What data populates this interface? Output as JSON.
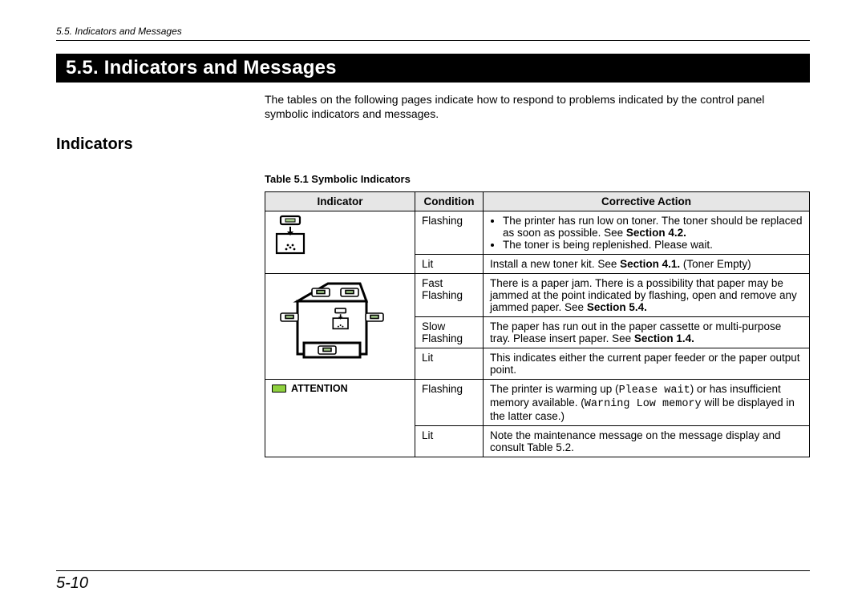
{
  "running_head": "5.5.  Indicators and Messages",
  "section_title": "5.5. Indicators and Messages",
  "intro_text": "The tables on the following pages indicate how to respond to problems indicated by the control panel symbolic indicators and messages.",
  "subhead": "Indicators",
  "table_caption": "Table 5.1  Symbolic Indicators",
  "headers": {
    "indicator": "Indicator",
    "condition": "Condition",
    "action": "Corrective Action"
  },
  "attention_label": "ATTENTION",
  "rows": {
    "r1": {
      "cond": "Flashing",
      "bullets": [
        {
          "pre": "The printer has run low on toner. The toner should be replaced as soon as possible. See ",
          "ref": "Section 4.2.",
          "post": ""
        },
        {
          "pre": "The toner is being replenished.  Please wait.",
          "ref": "",
          "post": ""
        }
      ]
    },
    "r2": {
      "cond": "Lit",
      "pre": "Install a new toner kit. See ",
      "ref": "Section 4.1.",
      "post": " (Toner Empty)"
    },
    "r3": {
      "cond": "Fast Flashing",
      "pre": "There is a paper jam. There is a possibility that paper may be jammed at the point indicated by flashing, open and remove any jammed paper. See ",
      "ref": "Section 5.4.",
      "post": ""
    },
    "r4": {
      "cond": "Slow Flashing",
      "pre": "The paper has run out in the paper cassette or multi-purpose tray. Please insert paper. See ",
      "ref": "Section 1.4.",
      "post": ""
    },
    "r5": {
      "cond": "Lit",
      "text": "This indicates either the current paper feeder or the paper output point."
    },
    "r6": {
      "cond": "Flashing",
      "t1": "The printer is warming up (",
      "code1": "Please wait",
      "t2": ") or has insufficient memory available. (",
      "code2": "Warning Low memory",
      "t3": " will be displayed in  the latter case.)"
    },
    "r7": {
      "cond": "Lit",
      "text": "Note the maintenance message on the message display and consult Table 5.2."
    }
  },
  "page_number": "5-10"
}
